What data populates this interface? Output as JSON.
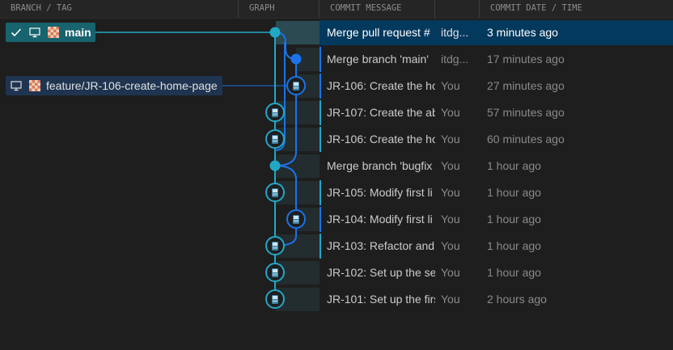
{
  "header": {
    "branch_tag": "BRANCH / TAG",
    "graph": "GRAPH",
    "commit_message": "COMMIT MESSAGE",
    "commit_date": "COMMIT DATE / TIME"
  },
  "branches": {
    "main": "main",
    "feature": "feature/JR-106-create-home-page"
  },
  "colors": {
    "main_lane": "#22a7c7",
    "feature_lane": "#1a73e8",
    "selected_row": "#04395e"
  },
  "commits": [
    {
      "message": "Merge pull request #",
      "author": "itdg...",
      "date": "3 minutes ago"
    },
    {
      "message": "Merge branch 'main'",
      "author": "itdg...",
      "date": "17 minutes ago"
    },
    {
      "message": "JR-106: Create the ho",
      "author": "You",
      "date": "27 minutes ago"
    },
    {
      "message": "JR-107: Create the ab",
      "author": "You",
      "date": "57 minutes ago"
    },
    {
      "message": "JR-106: Create the ho",
      "author": "You",
      "date": "60 minutes ago"
    },
    {
      "message": "Merge branch 'bugfix",
      "author": "You",
      "date": "1 hour ago"
    },
    {
      "message": "JR-105: Modify first li",
      "author": "You",
      "date": "1 hour ago"
    },
    {
      "message": "JR-104: Modify first li",
      "author": "You",
      "date": "1 hour ago"
    },
    {
      "message": "JR-103: Refactor and",
      "author": "You",
      "date": "1 hour ago"
    },
    {
      "message": "JR-102: Set up the se",
      "author": "You",
      "date": "1 hour ago"
    },
    {
      "message": "JR-101: Set up the firs",
      "author": "You",
      "date": "2 hours ago"
    }
  ]
}
